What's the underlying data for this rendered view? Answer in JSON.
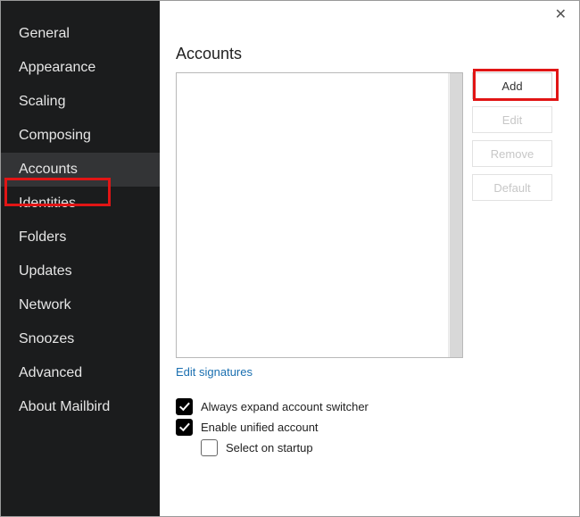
{
  "close_glyph": "✕",
  "sidebar": {
    "active_index": 4,
    "items": [
      {
        "label": "General"
      },
      {
        "label": "Appearance"
      },
      {
        "label": "Scaling"
      },
      {
        "label": "Composing"
      },
      {
        "label": "Accounts"
      },
      {
        "label": "Identities"
      },
      {
        "label": "Folders"
      },
      {
        "label": "Updates"
      },
      {
        "label": "Network"
      },
      {
        "label": "Snoozes"
      },
      {
        "label": "Advanced"
      },
      {
        "label": "About Mailbird"
      }
    ]
  },
  "main": {
    "title": "Accounts",
    "edit_signatures_link": "Edit signatures",
    "buttons": {
      "add": "Add",
      "edit": "Edit",
      "remove": "Remove",
      "default": "Default"
    },
    "checkboxes": {
      "always_expand": {
        "label": "Always expand account switcher",
        "checked": true
      },
      "enable_unified": {
        "label": "Enable unified account",
        "checked": true
      },
      "select_on_startup": {
        "label": "Select on startup",
        "checked": false
      }
    }
  }
}
